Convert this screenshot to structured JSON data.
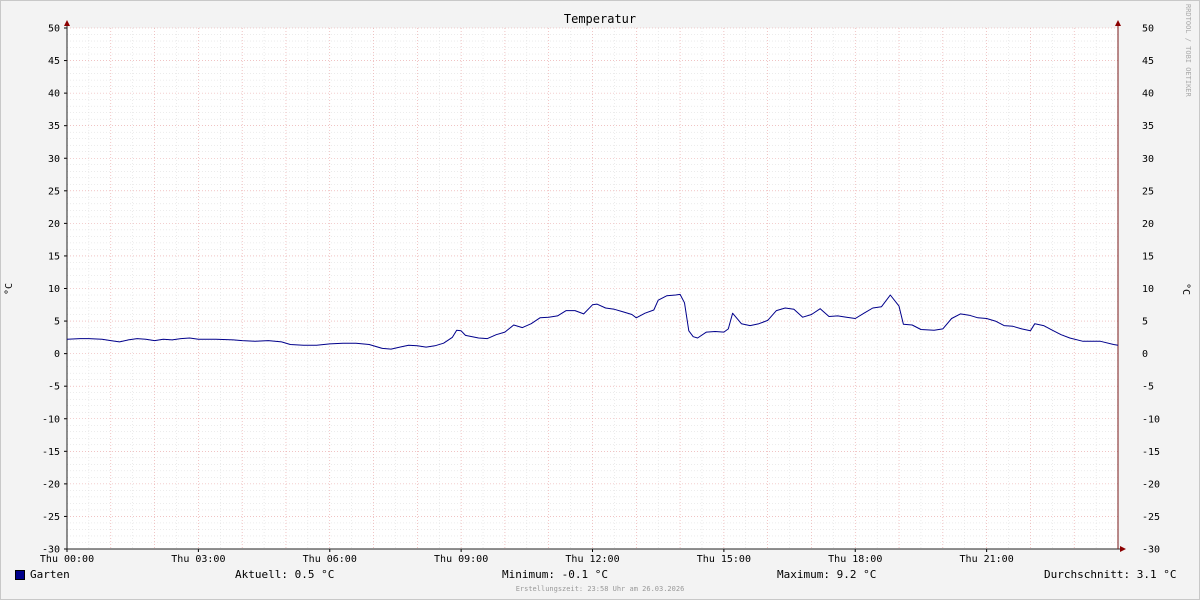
{
  "chart_data": {
    "type": "line",
    "title": "Temperatur",
    "ylabel": "°C",
    "ylim": [
      -30,
      50
    ],
    "yticks": [
      50,
      45,
      40,
      35,
      30,
      25,
      20,
      15,
      10,
      5,
      0,
      -5,
      -10,
      -15,
      -20,
      -25,
      -30
    ],
    "xlim": [
      0,
      24
    ],
    "xticks": [
      {
        "x": 0,
        "label": "Thu 00:00"
      },
      {
        "x": 3,
        "label": "Thu 03:00"
      },
      {
        "x": 6,
        "label": "Thu 06:00"
      },
      {
        "x": 9,
        "label": "Thu 09:00"
      },
      {
        "x": 12,
        "label": "Thu 12:00"
      },
      {
        "x": 15,
        "label": "Thu 15:00"
      },
      {
        "x": 18,
        "label": "Thu 18:00"
      },
      {
        "x": 21,
        "label": "Thu 21:00"
      }
    ],
    "grid": true,
    "series": [
      {
        "name": "Garten",
        "color": "#00008b",
        "points": [
          [
            0.0,
            2.2
          ],
          [
            0.3,
            2.3
          ],
          [
            0.5,
            2.3
          ],
          [
            0.8,
            2.2
          ],
          [
            1.0,
            2.0
          ],
          [
            1.2,
            1.8
          ],
          [
            1.4,
            2.1
          ],
          [
            1.6,
            2.3
          ],
          [
            1.8,
            2.2
          ],
          [
            2.0,
            2.0
          ],
          [
            2.2,
            2.2
          ],
          [
            2.4,
            2.1
          ],
          [
            2.6,
            2.3
          ],
          [
            2.8,
            2.4
          ],
          [
            3.0,
            2.2
          ],
          [
            3.4,
            2.2
          ],
          [
            3.8,
            2.1
          ],
          [
            4.0,
            2.0
          ],
          [
            4.3,
            1.9
          ],
          [
            4.6,
            2.0
          ],
          [
            4.9,
            1.8
          ],
          [
            5.1,
            1.4
          ],
          [
            5.4,
            1.3
          ],
          [
            5.7,
            1.3
          ],
          [
            6.0,
            1.5
          ],
          [
            6.3,
            1.6
          ],
          [
            6.6,
            1.6
          ],
          [
            6.9,
            1.4
          ],
          [
            7.2,
            0.8
          ],
          [
            7.4,
            0.7
          ],
          [
            7.6,
            1.0
          ],
          [
            7.8,
            1.3
          ],
          [
            8.0,
            1.2
          ],
          [
            8.2,
            1.0
          ],
          [
            8.4,
            1.2
          ],
          [
            8.6,
            1.6
          ],
          [
            8.8,
            2.5
          ],
          [
            8.9,
            3.6
          ],
          [
            9.0,
            3.5
          ],
          [
            9.1,
            2.8
          ],
          [
            9.4,
            2.4
          ],
          [
            9.6,
            2.3
          ],
          [
            9.8,
            2.9
          ],
          [
            10.0,
            3.3
          ],
          [
            10.2,
            4.4
          ],
          [
            10.4,
            4.0
          ],
          [
            10.6,
            4.6
          ],
          [
            10.8,
            5.5
          ],
          [
            11.0,
            5.6
          ],
          [
            11.2,
            5.8
          ],
          [
            11.4,
            6.6
          ],
          [
            11.6,
            6.6
          ],
          [
            11.8,
            6.1
          ],
          [
            12.0,
            7.5
          ],
          [
            12.1,
            7.6
          ],
          [
            12.3,
            7.0
          ],
          [
            12.5,
            6.8
          ],
          [
            12.7,
            6.4
          ],
          [
            12.9,
            6.0
          ],
          [
            13.0,
            5.5
          ],
          [
            13.2,
            6.2
          ],
          [
            13.4,
            6.7
          ],
          [
            13.5,
            8.2
          ],
          [
            13.7,
            8.9
          ],
          [
            13.9,
            9.0
          ],
          [
            14.0,
            9.1
          ],
          [
            14.1,
            7.8
          ],
          [
            14.2,
            3.5
          ],
          [
            14.3,
            2.6
          ],
          [
            14.4,
            2.4
          ],
          [
            14.6,
            3.3
          ],
          [
            14.8,
            3.4
          ],
          [
            15.0,
            3.3
          ],
          [
            15.1,
            3.8
          ],
          [
            15.2,
            6.2
          ],
          [
            15.4,
            4.6
          ],
          [
            15.6,
            4.3
          ],
          [
            15.8,
            4.6
          ],
          [
            16.0,
            5.1
          ],
          [
            16.2,
            6.6
          ],
          [
            16.4,
            7.0
          ],
          [
            16.6,
            6.8
          ],
          [
            16.8,
            5.6
          ],
          [
            17.0,
            6.0
          ],
          [
            17.2,
            6.9
          ],
          [
            17.4,
            5.7
          ],
          [
            17.6,
            5.8
          ],
          [
            17.8,
            5.6
          ],
          [
            18.0,
            5.4
          ],
          [
            18.2,
            6.2
          ],
          [
            18.4,
            7.0
          ],
          [
            18.6,
            7.2
          ],
          [
            18.8,
            9.0
          ],
          [
            19.0,
            7.3
          ],
          [
            19.1,
            4.5
          ],
          [
            19.3,
            4.4
          ],
          [
            19.5,
            3.7
          ],
          [
            19.8,
            3.6
          ],
          [
            20.0,
            3.8
          ],
          [
            20.2,
            5.4
          ],
          [
            20.4,
            6.1
          ],
          [
            20.6,
            5.9
          ],
          [
            20.8,
            5.5
          ],
          [
            21.0,
            5.4
          ],
          [
            21.2,
            5.0
          ],
          [
            21.4,
            4.3
          ],
          [
            21.6,
            4.2
          ],
          [
            21.8,
            3.8
          ],
          [
            22.0,
            3.5
          ],
          [
            22.1,
            4.6
          ],
          [
            22.3,
            4.3
          ],
          [
            22.5,
            3.6
          ],
          [
            22.7,
            2.9
          ],
          [
            22.9,
            2.4
          ],
          [
            23.2,
            1.9
          ],
          [
            23.6,
            1.9
          ],
          [
            23.9,
            1.4
          ],
          [
            24.0,
            1.3
          ]
        ]
      }
    ]
  },
  "x_scale_hours": 24,
  "credit": "RRDTOOL / TOBI OETIKER",
  "legend": {
    "series_name": "Garten",
    "current": "Aktuell: 0.5 °C",
    "minimum": "Minimum: -0.1 °C",
    "maximum": "Maximum: 9.2 °C",
    "average": "Durchschnitt: 3.1 °C"
  },
  "creation_time": "Erstellungszeit: 23:58 Uhr am 26.03.2026"
}
